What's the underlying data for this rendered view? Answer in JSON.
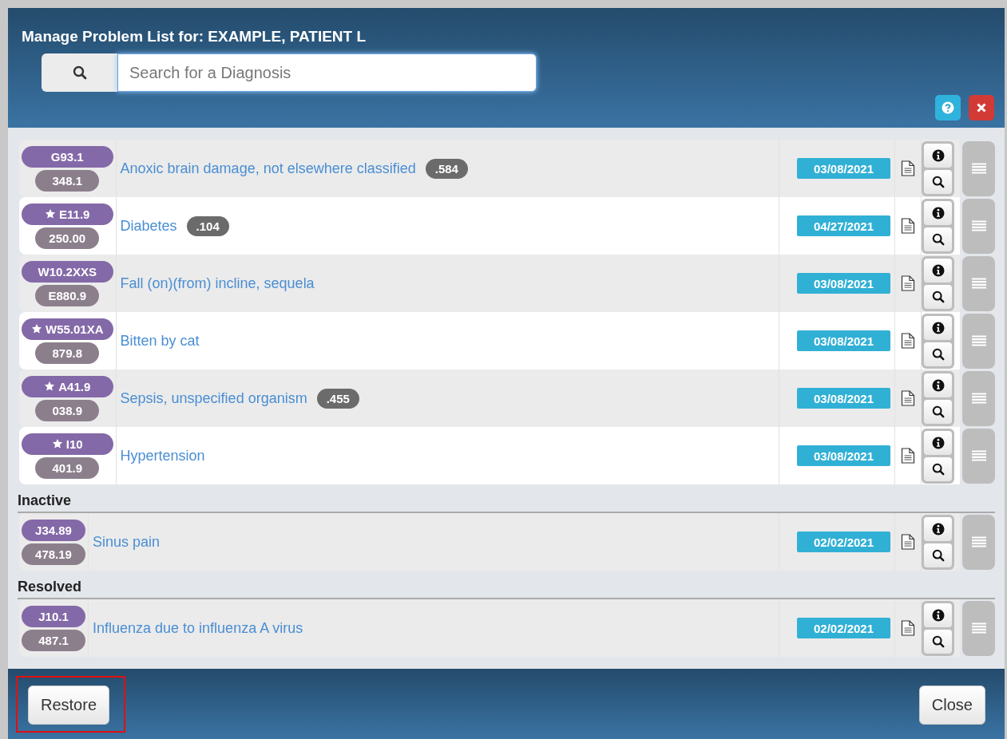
{
  "dialog": {
    "title": "Manage Problem List for: EXAMPLE, PATIENT L",
    "search": {
      "placeholder": "Search for a Diagnosis"
    }
  },
  "sections": [
    {
      "rows": [
        {
          "code": "G93.1",
          "icd9": "348.1",
          "starred": false,
          "description": "Anoxic brain damage, not elsewhere classified",
          "score": ".584",
          "date": "03/08/2021"
        },
        {
          "code": "E11.9",
          "icd9": "250.00",
          "starred": true,
          "description": "Diabetes",
          "score": ".104",
          "date": "04/27/2021"
        },
        {
          "code": "W10.2XXS",
          "icd9": "E880.9",
          "starred": false,
          "description": "Fall (on)(from) incline, sequela",
          "date": "03/08/2021"
        },
        {
          "code": "W55.01XA",
          "icd9": "879.8",
          "starred": true,
          "description": "Bitten by cat",
          "date": "03/08/2021"
        },
        {
          "code": "A41.9",
          "icd9": "038.9",
          "starred": true,
          "description": "Sepsis, unspecified organism",
          "score": ".455",
          "date": "03/08/2021"
        },
        {
          "code": "I10",
          "icd9": "401.9",
          "starred": true,
          "description": "Hypertension",
          "date": "03/08/2021"
        }
      ]
    },
    {
      "heading": "Inactive",
      "rows": [
        {
          "code": "J34.89",
          "icd9": "478.19",
          "starred": false,
          "description": "Sinus pain",
          "date": "02/02/2021"
        }
      ]
    },
    {
      "heading": "Resolved",
      "rows": [
        {
          "code": "J10.1",
          "icd9": "487.1",
          "starred": false,
          "description": "Influenza due to influenza A virus",
          "date": "02/02/2021"
        }
      ]
    }
  ],
  "footer": {
    "buttons": [
      {
        "label": "Restore",
        "highlighted": true
      },
      {
        "label": "Close",
        "highlighted": false
      }
    ]
  }
}
